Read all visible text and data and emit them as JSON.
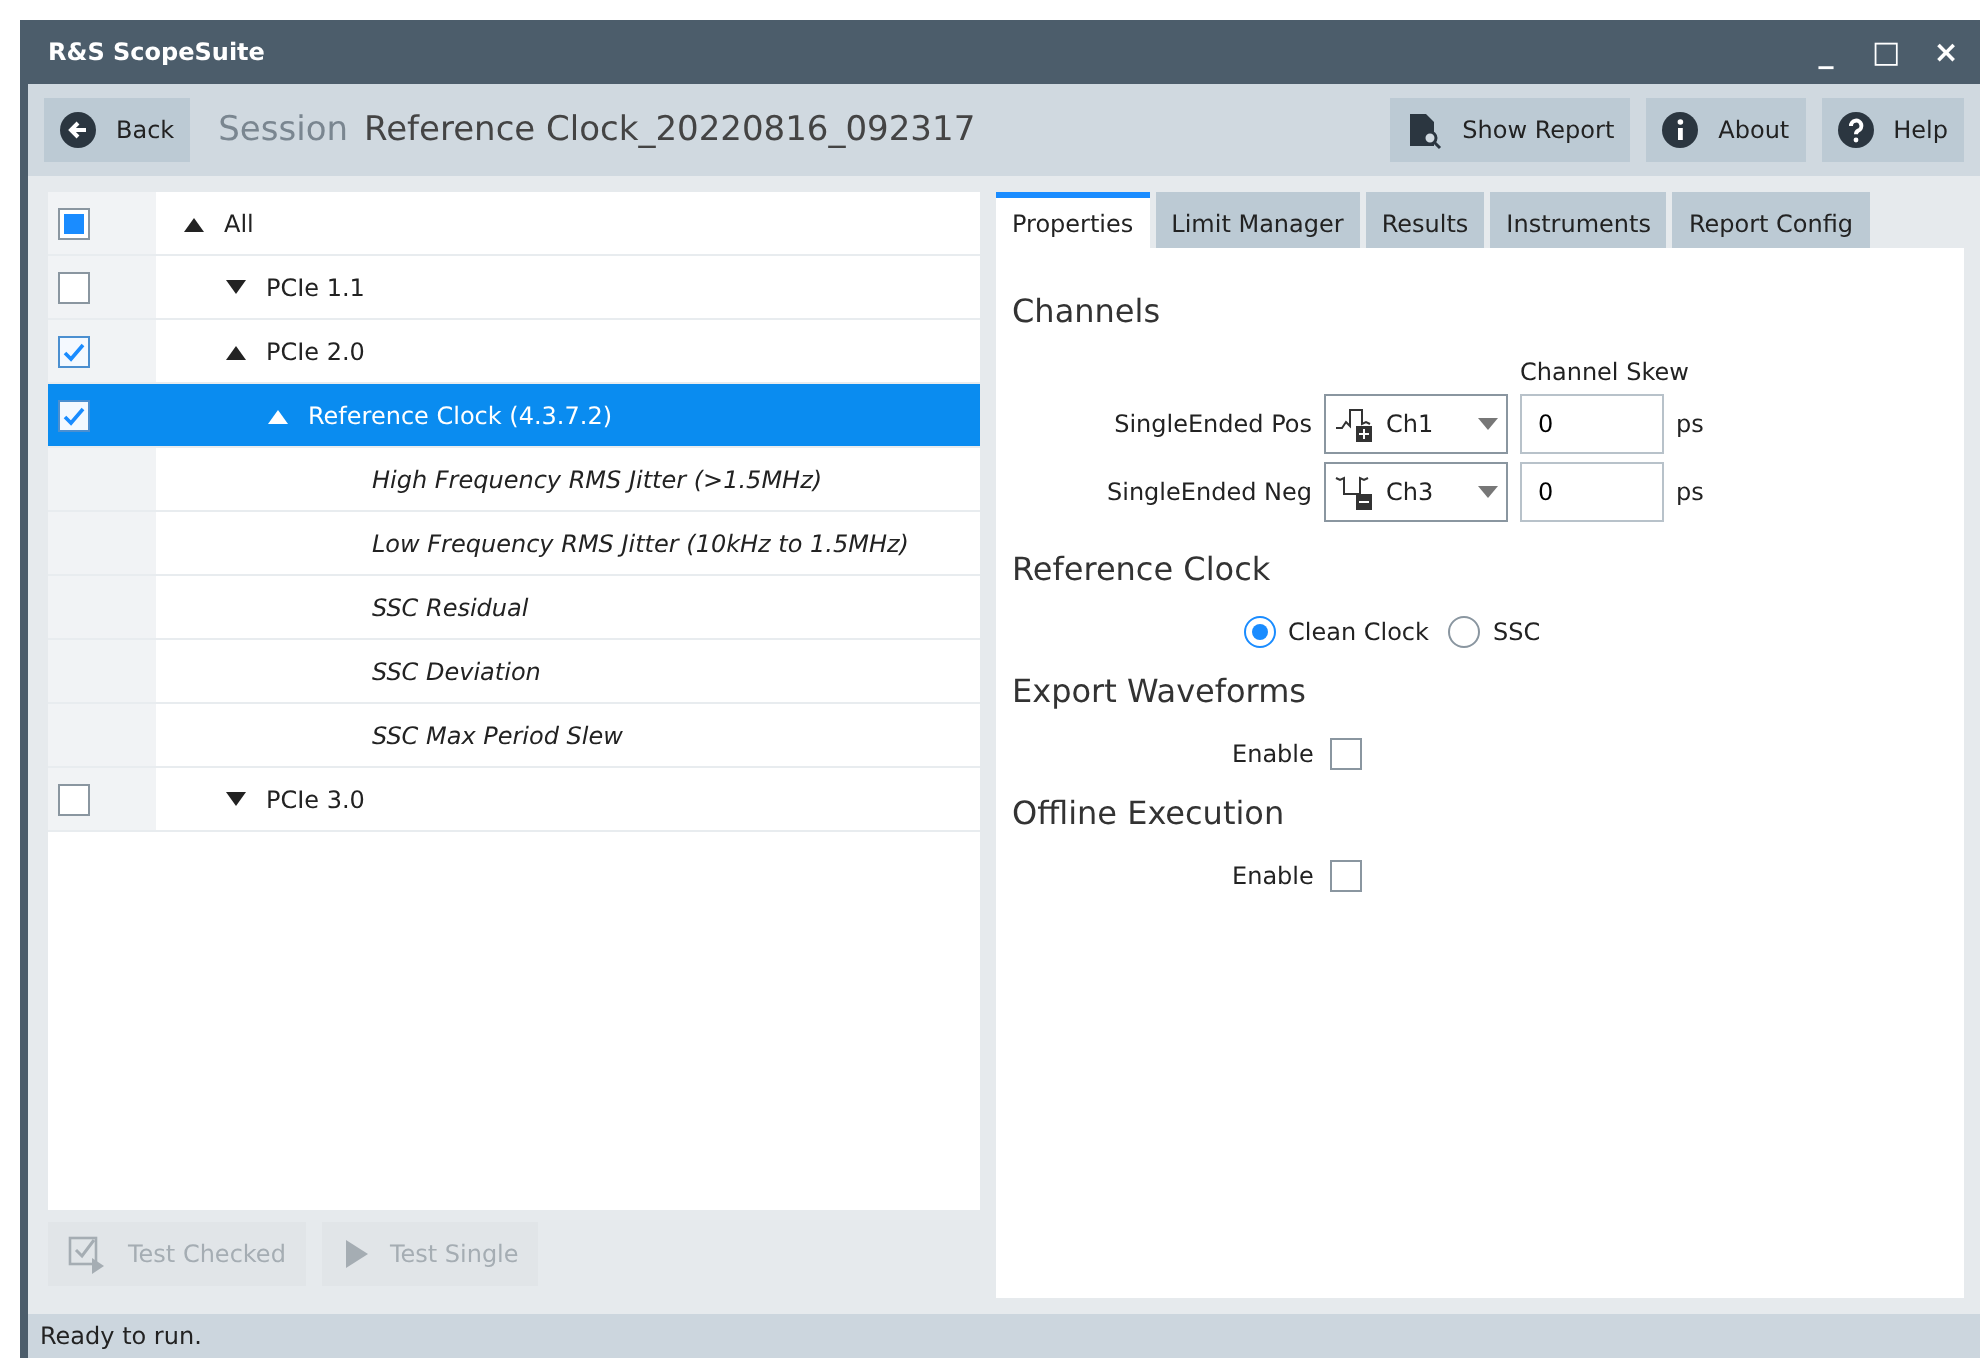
{
  "window": {
    "title": "R&S ScopeSuite",
    "controls": [
      "_",
      "□",
      "×"
    ]
  },
  "toolbar": {
    "back": "Back",
    "session_label": "Session",
    "session_name": "Reference Clock_20220816_092317",
    "buttons": [
      {
        "label": "Show Report",
        "kind": "report"
      },
      {
        "label": "About",
        "kind": "info"
      },
      {
        "label": "Help",
        "kind": "help"
      }
    ]
  },
  "tree": [
    {
      "label": "All",
      "kind": "group",
      "checked": false,
      "indeterminate": true,
      "expanded": true,
      "selected": false,
      "children": [
        {
          "label": "PCIe 1.1",
          "kind": "group",
          "checked": false,
          "indeterminate": false,
          "expanded": false,
          "selected": false
        },
        {
          "label": "PCIe 2.0",
          "kind": "group",
          "checked": true,
          "indeterminate": false,
          "expanded": true,
          "selected": false,
          "children": [
            {
              "label": "Reference Clock (4.3.7.2)",
              "kind": "group",
              "checked": true,
              "indeterminate": false,
              "expanded": true,
              "selected": true,
              "children": [
                {
                  "label": "High Frequency RMS Jitter (>1.5MHz)",
                  "kind": "test",
                  "selected": false
                },
                {
                  "label": "Low Frequency RMS Jitter (10kHz to 1.5MHz)",
                  "kind": "test",
                  "selected": false
                },
                {
                  "label": "SSC Residual",
                  "kind": "test",
                  "selected": false
                },
                {
                  "label": "SSC Deviation",
                  "kind": "test",
                  "selected": false
                },
                {
                  "label": "SSC Max Period Slew",
                  "kind": "test",
                  "selected": false
                }
              ]
            }
          ]
        },
        {
          "label": "PCIe 3.0",
          "kind": "group",
          "checked": false,
          "indeterminate": false,
          "expanded": false,
          "selected": false
        }
      ]
    }
  ],
  "run_buttons": [
    {
      "label": "Test Checked",
      "kind": "checked",
      "disabled": true
    },
    {
      "label": "Test Single",
      "kind": "single",
      "disabled": true
    }
  ],
  "tabs": [
    {
      "label": "Properties",
      "selected": true
    },
    {
      "label": "Limit Manager",
      "selected": false
    },
    {
      "label": "Results",
      "selected": false
    },
    {
      "label": "Instruments",
      "selected": false
    },
    {
      "label": "Report Config",
      "selected": false
    }
  ],
  "properties": {
    "channels": {
      "title": "Channels",
      "skew_header": "Channel Skew",
      "rows": [
        {
          "label": "SingleEnded Pos",
          "kind": "pos",
          "channel": "Ch1",
          "skew": "0",
          "unit": "ps"
        },
        {
          "label": "SingleEnded Neg",
          "kind": "neg",
          "channel": "Ch3",
          "skew": "0",
          "unit": "ps"
        }
      ]
    },
    "reference_clock": {
      "title": "Reference Clock",
      "options": [
        {
          "label": "Clean Clock",
          "selected": true
        },
        {
          "label": "SSC",
          "selected": false
        }
      ]
    },
    "export_waveforms": {
      "title": "Export Waveforms",
      "label": "Enable",
      "checked": false
    },
    "offline_execution": {
      "title": "Offline Execution",
      "label": "Enable",
      "checked": false
    }
  },
  "status_bar": "Ready to run."
}
